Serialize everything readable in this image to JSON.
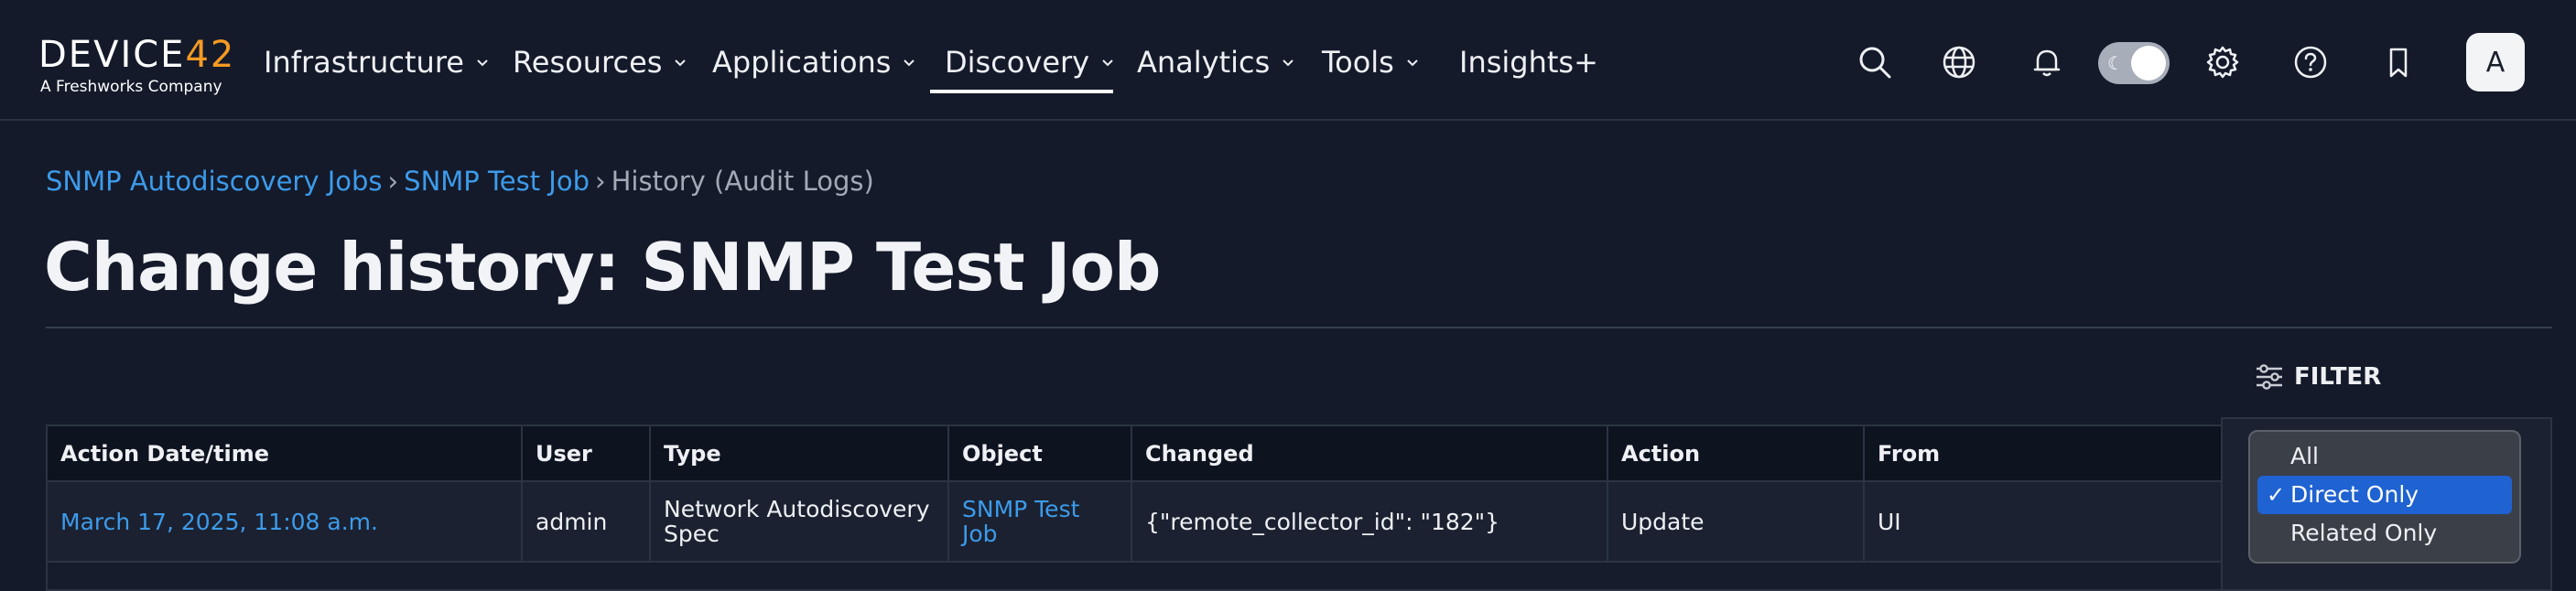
{
  "brand": {
    "logo_main": "DEVICE",
    "logo_num": "42",
    "logo_sub": "A Freshworks Company"
  },
  "nav": {
    "items": [
      {
        "label": "Infrastructure",
        "has_dropdown": true
      },
      {
        "label": "Resources",
        "has_dropdown": true
      },
      {
        "label": "Applications",
        "has_dropdown": true
      },
      {
        "label": "Discovery",
        "has_dropdown": true,
        "active": true
      },
      {
        "label": "Analytics",
        "has_dropdown": true
      },
      {
        "label": "Tools",
        "has_dropdown": true
      },
      {
        "label": "Insights+",
        "has_dropdown": false
      }
    ],
    "icons": [
      "search-icon",
      "globe-icon",
      "bell-icon",
      "theme-toggle",
      "gear-icon",
      "help-icon",
      "bookmark-icon"
    ],
    "avatar_letter": "A"
  },
  "breadcrumb": {
    "items": [
      {
        "label": "SNMP Autodiscovery Jobs",
        "link": true
      },
      {
        "label": "SNMP Test Job",
        "link": true
      },
      {
        "label": "History (Audit Logs)",
        "link": false
      }
    ],
    "separator": "›"
  },
  "page": {
    "title": "Change history: SNMP Test Job"
  },
  "filter": {
    "label": "FILTER",
    "options": [
      "All",
      "Direct Only",
      "Related Only"
    ],
    "selected": "Direct Only"
  },
  "table": {
    "columns": [
      "Action Date/time",
      "User",
      "Type",
      "Object",
      "Changed",
      "Action",
      "From"
    ],
    "rows": [
      {
        "datetime": "March 17, 2025, 11:08 a.m.",
        "user": "admin",
        "type": "Network Autodiscovery Spec",
        "object": "SNMP Test Job",
        "changed": "{\"remote_collector_id\": \"182\"}",
        "action": "Update",
        "from": "UI"
      }
    ]
  },
  "colors": {
    "background": "#141a2a",
    "link": "#3d9bea",
    "accent_selected": "#1f62d1",
    "logo_accent": "#f59a23"
  }
}
